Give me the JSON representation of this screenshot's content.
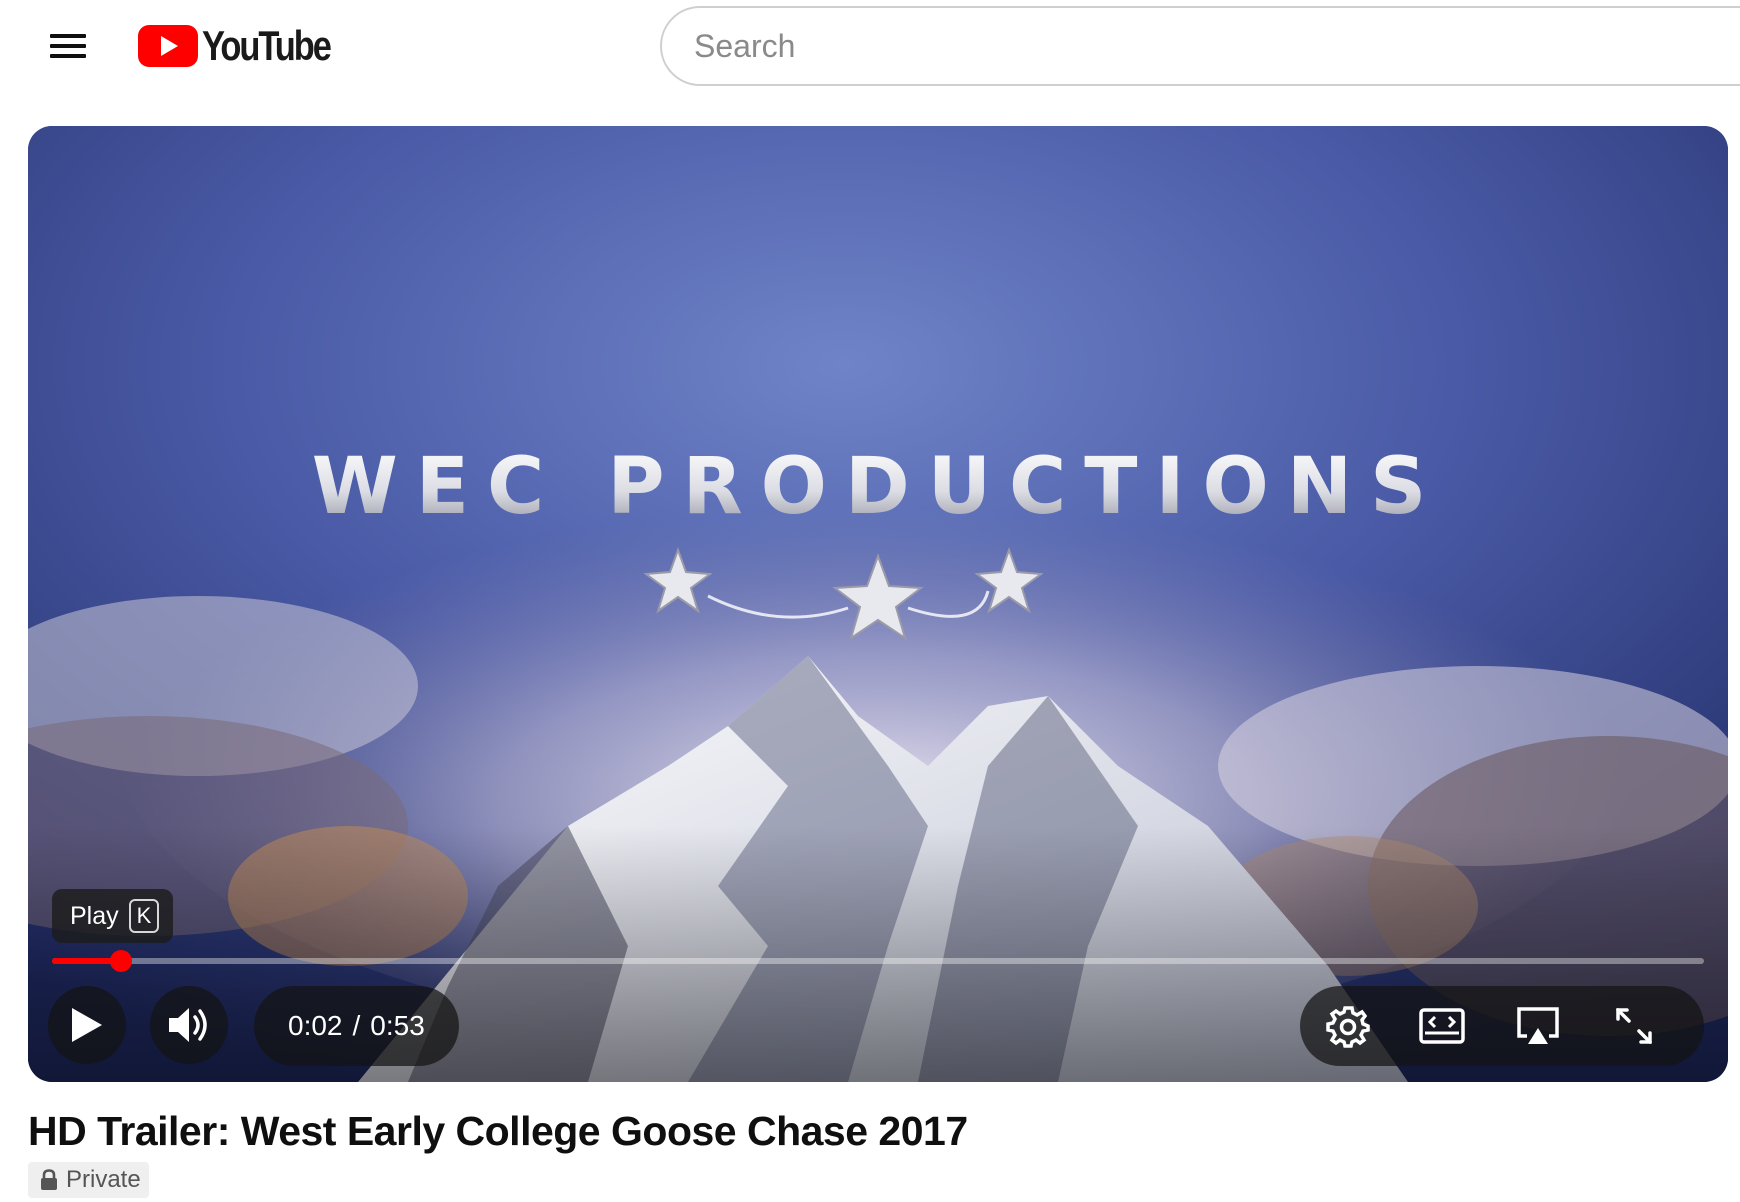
{
  "header": {
    "logo_text": "YouTube",
    "search_placeholder": "Search",
    "brand_color": "#ff0000"
  },
  "video": {
    "frame_text": "WEC PRODUCTIONS",
    "tooltip": {
      "label": "Play",
      "key": "K"
    },
    "time": {
      "current": "0:02",
      "separator": "/",
      "duration": "0:53"
    },
    "progress_fraction": 0.042,
    "controls": [
      "play-icon",
      "volume-icon",
      "settings-icon",
      "theater-mode-icon",
      "airplay-icon",
      "fullscreen-icon"
    ]
  },
  "details": {
    "title": "HD Trailer: West Early College Goose Chase 2017",
    "visibility": "Private"
  }
}
